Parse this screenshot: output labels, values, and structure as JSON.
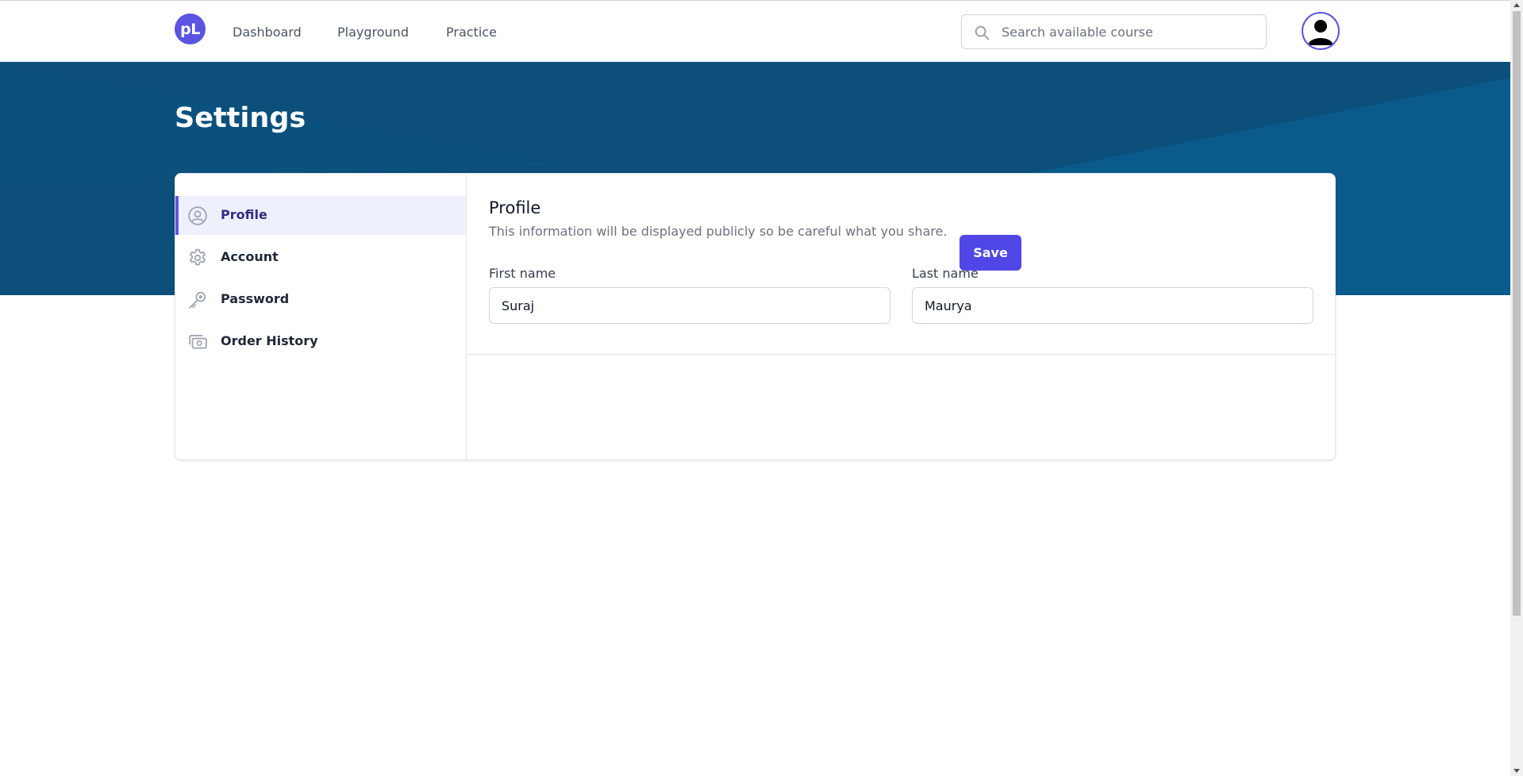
{
  "app": {
    "logo_text": "pL",
    "brand_color": "#5b54e0"
  },
  "nav": {
    "links": [
      {
        "label": "Dashboard"
      },
      {
        "label": "Playground"
      },
      {
        "label": "Practice"
      }
    ],
    "search": {
      "placeholder": "Search available course",
      "value": "",
      "icon": "search-icon"
    },
    "avatar_icon": "user-avatar-icon"
  },
  "hero": {
    "title": "Settings",
    "background_color": "#0b4f7a"
  },
  "sidebar": {
    "items": [
      {
        "label": "Profile",
        "icon": "user-circle-icon",
        "active": true
      },
      {
        "label": "Account",
        "icon": "gear-icon",
        "active": false
      },
      {
        "label": "Password",
        "icon": "key-icon",
        "active": false
      },
      {
        "label": "Order History",
        "icon": "cash-icon",
        "active": false
      }
    ]
  },
  "profile": {
    "title": "Profile",
    "description": "This information will be displayed publicly so be careful what you share.",
    "first_name": {
      "label": "First name",
      "value": "Suraj"
    },
    "last_name": {
      "label": "Last name",
      "value": "Maurya"
    },
    "save_label": "Save",
    "save_color": "#4f46e5"
  }
}
